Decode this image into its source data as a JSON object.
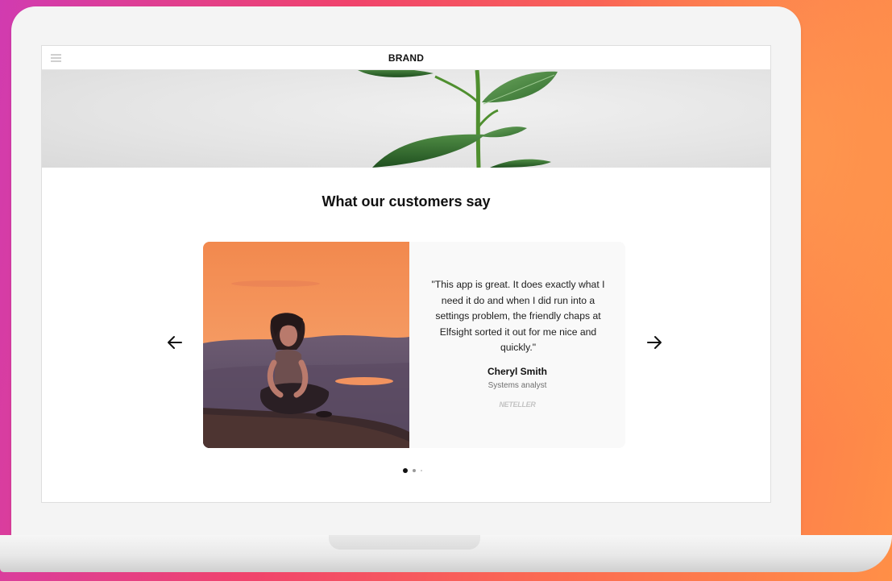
{
  "header": {
    "brand": "BRAND",
    "menu_icon": "hamburger-menu-icon"
  },
  "testimonials": {
    "title": "What our customers say",
    "prev_icon": "arrow-left-icon",
    "next_icon": "arrow-right-icon",
    "active_slide": 1,
    "slide_count": 3,
    "current": {
      "quote": "\"This app is great. It does exactly what I need it do and when I did run into a settings problem, the friendly chaps at Elfsight sorted it out for me nice and quickly.\"",
      "name": "Cheryl Smith",
      "role": "Systems analyst",
      "company": "NETELLER"
    }
  },
  "colors": {
    "background_gradient": [
      "#d13bb0",
      "#f0436c",
      "#fb6a52",
      "#ff8f47"
    ],
    "card_background": "#f9f9f9",
    "active_dot": "#111111",
    "inactive_dot": "#9a9a9a"
  }
}
